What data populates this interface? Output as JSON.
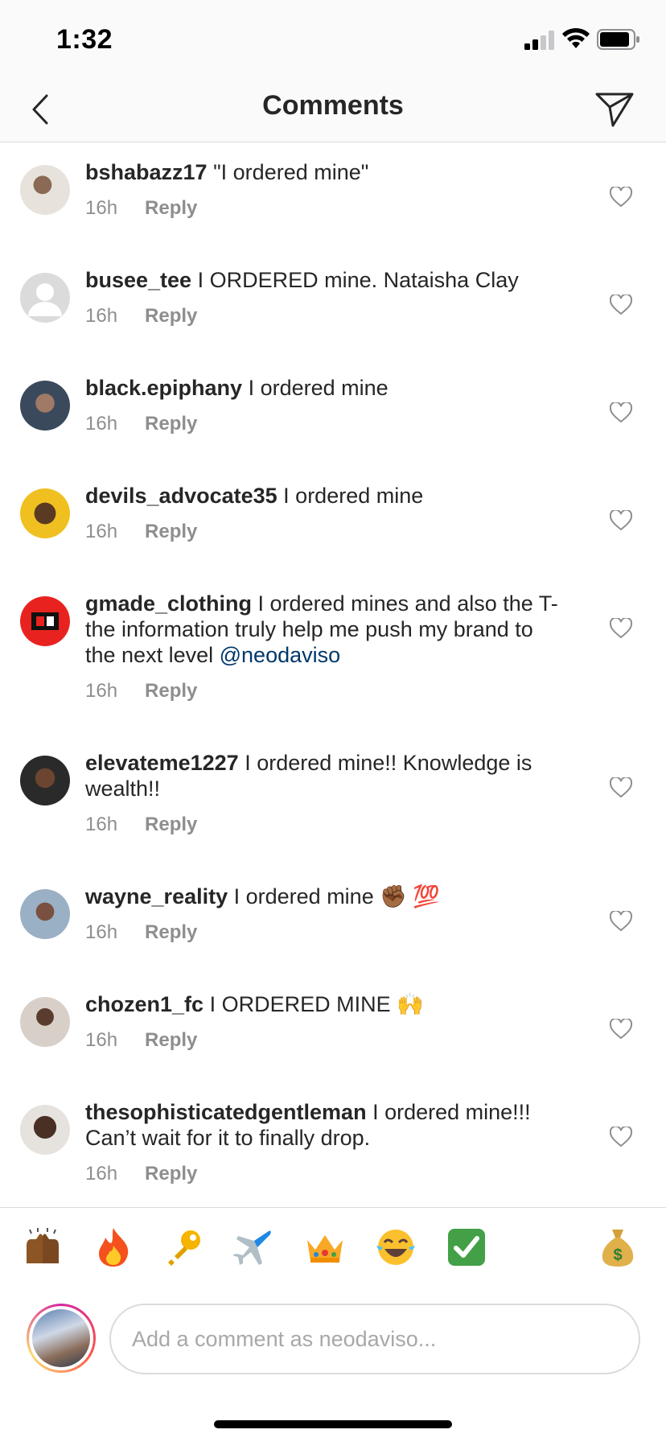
{
  "status_bar": {
    "time": "1:32"
  },
  "header": {
    "title": "Comments"
  },
  "comments": [
    {
      "username": "bshabazz17",
      "text": "\"I ordered mine\"",
      "time": "16h",
      "reply": "Reply"
    },
    {
      "username": "busee_tee",
      "text": "I ORDERED mine. Nataisha Clay",
      "time": "16h",
      "reply": "Reply"
    },
    {
      "username": "black.epiphany",
      "text": "I ordered mine",
      "time": "16h",
      "reply": "Reply"
    },
    {
      "username": "devils_advocate35",
      "text": "I ordered mine",
      "time": "16h",
      "reply": "Reply"
    },
    {
      "username": "gmade_clothing",
      "text": "I ordered mines and also the T-  the information truly help me push my brand to the next level",
      "mention": "@neodaviso",
      "time": "16h",
      "reply": "Reply"
    },
    {
      "username": "elevateme1227",
      "text": "I ordered mine!! Knowledge is wealth!!",
      "time": "16h",
      "reply": "Reply"
    },
    {
      "username": "wayne_reality",
      "text": "I ordered mine ✊🏾 💯",
      "time": "16h",
      "reply": "Reply"
    },
    {
      "username": "chozen1_fc",
      "text": "I ORDERED MINE 🙌",
      "time": "16h",
      "reply": "Reply"
    },
    {
      "username": "thesophisticatedgentleman",
      "text": "I ordered mine!!! Can’t wait for it to finally drop.",
      "time": "16h",
      "reply": "Reply"
    }
  ],
  "emoji_bar": [
    "🙌🏾",
    "🔥",
    "🔑",
    "✈️",
    "👑",
    "😂",
    "✅",
    "💰"
  ],
  "composer": {
    "placeholder": "Add a comment as neodaviso..."
  },
  "colors": {
    "mention": "#00376b",
    "meta": "#8e8e8e",
    "border": "#dbdbdb"
  }
}
